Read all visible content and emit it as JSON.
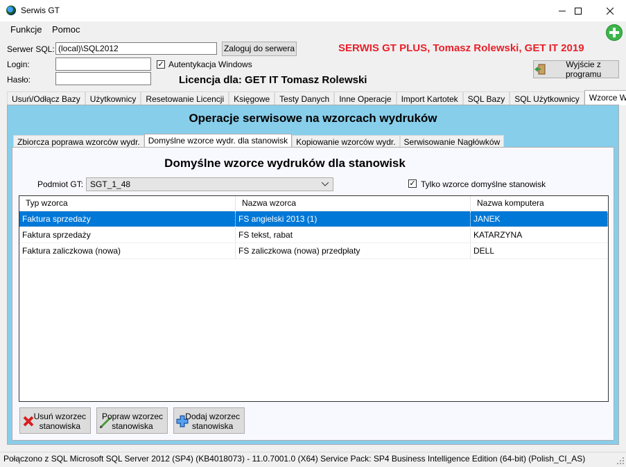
{
  "window": {
    "title": "Serwis GT"
  },
  "menu": {
    "items": [
      "Funkcje",
      "Pomoc"
    ]
  },
  "login": {
    "server_label": "Serwer SQL:",
    "server_value": "(local)\\SQL2012",
    "login_label": "Login:",
    "login_value": "",
    "password_label": "Hasło:",
    "password_value": "",
    "connect_button": "Zaloguj do serwera",
    "windows_auth_label": "Autentykacja Windows",
    "windows_auth_checked": true
  },
  "header": {
    "product_title": "SERWIS GT PLUS, Tomasz Rolewski, GET IT 2019",
    "license": "Licencja dla: GET IT Tomasz Rolewski",
    "exit_button": "Wyjście z programu",
    "accent_red": "#e8202a"
  },
  "main_tabs": [
    "Usuń/Odłącz Bazy",
    "Użytkownicy",
    "Resetowanie Licencji",
    "Księgowe",
    "Testy Danych",
    "Inne Operacje",
    "Import Kartotek",
    "SQL Bazy",
    "SQL Użytkownicy",
    "Wzorce Wydruku"
  ],
  "main_tab_active": 9,
  "panel": {
    "title": "Operacje serwisowe na wzorcach wydruków",
    "sub_tabs": [
      "Zbiorcza poprawa wzorców wydr.",
      "Domyślne wzorce wydr. dla stanowisk",
      "Kopiowanie wzorców wydr.",
      "Serwisowanie Nagłówków"
    ],
    "sub_tab_active": 1,
    "sub_title": "Domyślne wzorce wydruków dla stanowisk",
    "podmiot_label": "Podmiot GT:",
    "podmiot_value": "SGT_1_48",
    "only_default_label": "Tylko wzorce domyślne stanowisk",
    "only_default_checked": true,
    "grid": {
      "columns": [
        "Typ wzorca",
        "Nazwa wzorca",
        "Nazwa komputera"
      ],
      "rows": [
        [
          "Faktura sprzedaży",
          "FS angielski 2013 (1)",
          "JANEK"
        ],
        [
          "Faktura sprzedaży",
          "FS tekst, rabat",
          "KATARZYNA"
        ],
        [
          "Faktura zaliczkowa (nowa)",
          "FS zaliczkowa (nowa) przedpłaty",
          "DELL"
        ]
      ],
      "selected_row": 0
    },
    "buttons": {
      "delete": "Usuń wzorzec\nstanowiska",
      "edit": "Popraw wzorzec\nstanowiska",
      "add": "Dodaj wzorzec\nstanowiska"
    }
  },
  "status": {
    "text": "Połączono z SQL  Microsoft SQL Server 2012 (SP4) (KB4018073) - 11.0.7001.0 (X64)  Service Pack: SP4 Business Intelligence Edition (64-bit) (Polish_CI_AS)"
  }
}
